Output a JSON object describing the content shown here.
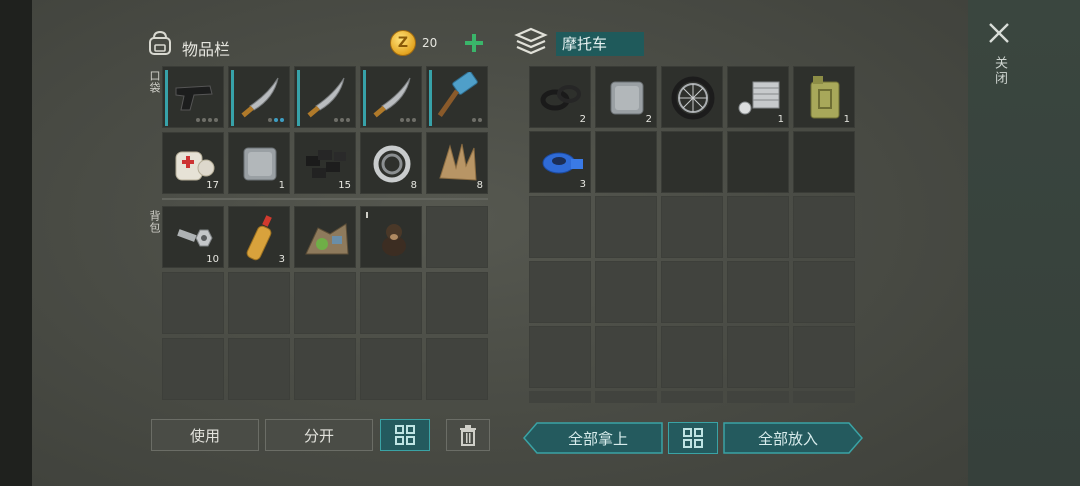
{
  "inventory": {
    "title": "物品栏",
    "coins": "20",
    "pocket_label": "口袋",
    "backpack_label": "背包",
    "pocket_counts": [
      "",
      "",
      "",
      "",
      "",
      "17",
      "1",
      "15",
      "8",
      "8"
    ],
    "backpack_counts": [
      "10",
      "3",
      "",
      "",
      ""
    ]
  },
  "container": {
    "title": "摩托车",
    "counts": [
      "2",
      "2",
      "",
      "1",
      "1",
      "3"
    ]
  },
  "buttons": {
    "use": "使用",
    "split": "分开",
    "take_all": "全部拿上",
    "put_all": "全部放入"
  },
  "close": {
    "label": "关闭"
  },
  "colors": {
    "accent_teal": "#37a2a9",
    "coin_gold": "#e3a521",
    "plus_green": "#3ab56a"
  },
  "icons": [
    "backpack-icon",
    "coin-icon",
    "plus-icon",
    "container-stack-icon",
    "close-icon",
    "grid-sort-icon",
    "trash-icon"
  ]
}
